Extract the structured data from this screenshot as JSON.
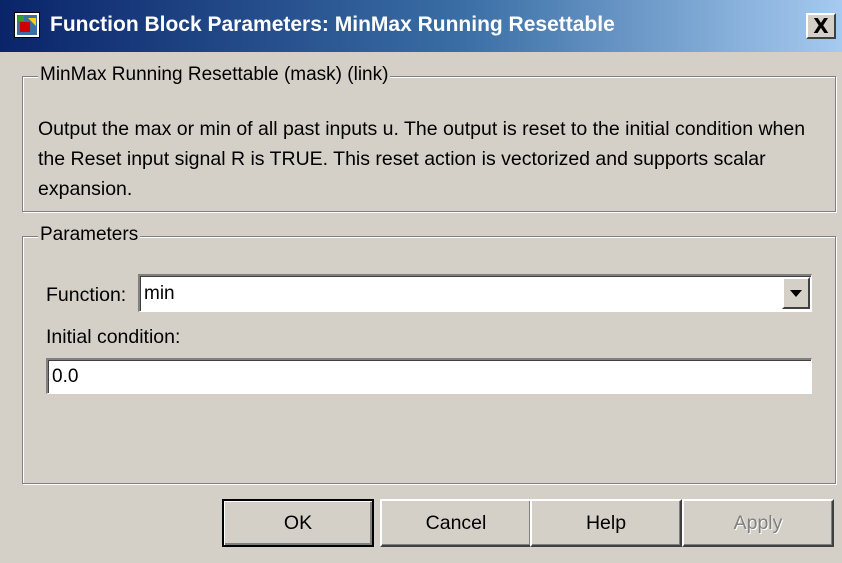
{
  "window": {
    "title": "Function Block Parameters: MinMax Running Resettable",
    "close_label": "X"
  },
  "description_group": {
    "legend": "MinMax Running Resettable (mask) (link)",
    "text": "Output the max or min of all past inputs u.  The output is reset to the initial condition when the Reset input signal R is TRUE.  This reset action is vectorized and supports scalar expansion."
  },
  "parameters_group": {
    "legend": "Parameters",
    "function_label": "Function:",
    "function_value": "min",
    "initial_condition_label": "Initial condition:",
    "initial_condition_value": "0.0"
  },
  "buttons": {
    "ok": "OK",
    "cancel": "Cancel",
    "help": "Help",
    "apply": "Apply"
  },
  "icons": {
    "app_icon": "simulink-block-icon",
    "close_icon": "close-icon",
    "dropdown_icon": "chevron-down-icon"
  },
  "colors": {
    "titlebar_start": "#0a246a",
    "titlebar_end": "#a6caf0",
    "dialog_background": "#d4d0c8"
  }
}
